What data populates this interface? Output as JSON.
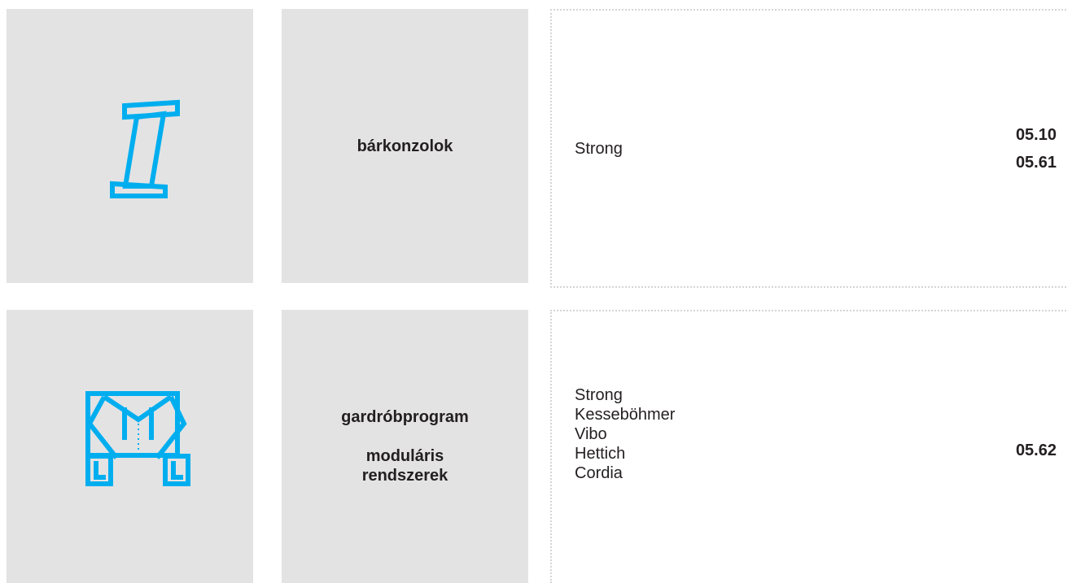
{
  "icons": {
    "color": "#00aeef",
    "row1_icon": "bar-bracket-icon",
    "row2_icon": "wardrobe-system-icon"
  },
  "rows": [
    {
      "title": "bárkonzolok",
      "brands": [
        "Strong"
      ],
      "codes": [
        "05.10",
        "05.61"
      ]
    },
    {
      "title": "gardróbprogram",
      "subtitle": "moduláris rendszerek",
      "brands": [
        "Strong",
        "Kesseböhmer",
        "Vibo",
        "Hettich",
        "Cordia"
      ],
      "codes": [
        "05.62"
      ]
    }
  ]
}
